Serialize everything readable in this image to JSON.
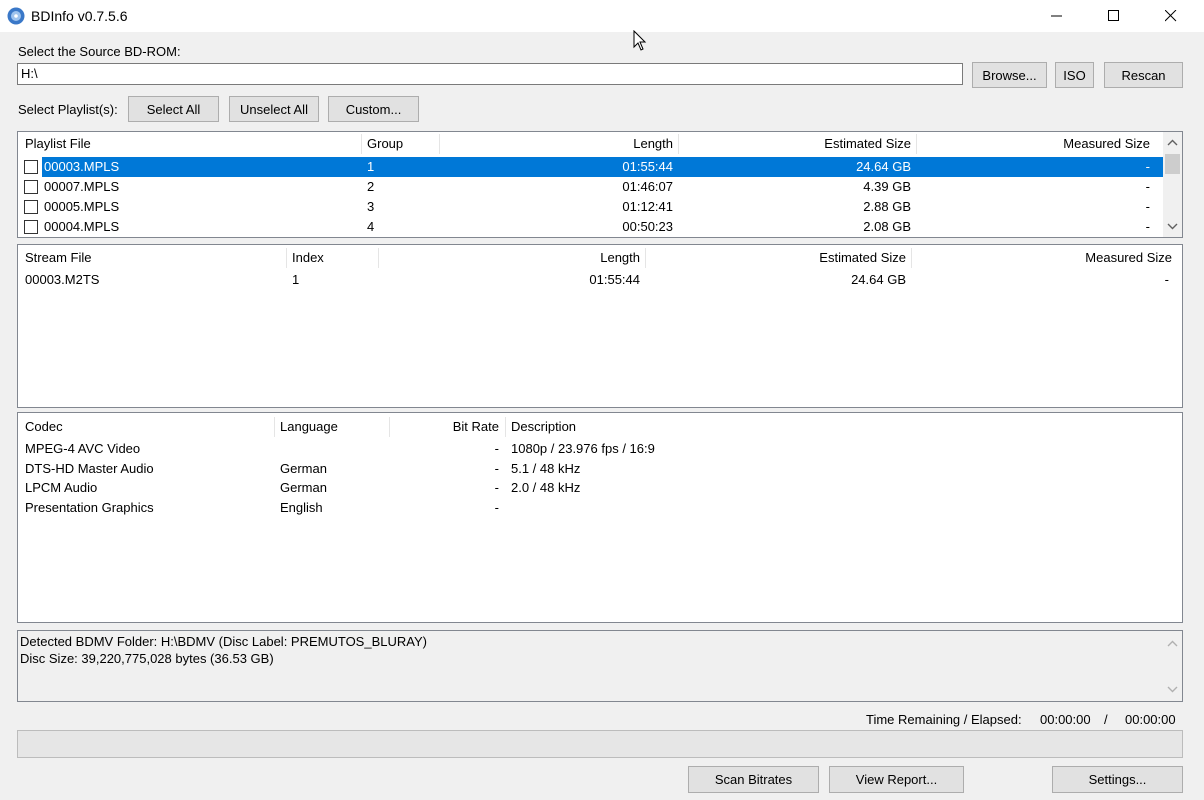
{
  "window": {
    "title": "BDInfo v0.7.5.6"
  },
  "source": {
    "label": "Select the Source BD-ROM:",
    "value": "H:\\",
    "browse_label": "Browse...",
    "iso_label": "ISO",
    "rescan_label": "Rescan"
  },
  "playlist_controls": {
    "label": "Select Playlist(s):",
    "select_all": "Select All",
    "unselect_all": "Unselect All",
    "custom": "Custom..."
  },
  "playlists": {
    "columns": [
      "Playlist File",
      "Group",
      "Length",
      "Estimated Size",
      "Measured Size"
    ],
    "rows": [
      {
        "file": "00003.MPLS",
        "group": "1",
        "length": "01:55:44",
        "estimated": "24.64 GB",
        "measured": "-",
        "selected": true,
        "checked": false
      },
      {
        "file": "00007.MPLS",
        "group": "2",
        "length": "01:46:07",
        "estimated": "4.39 GB",
        "measured": "-",
        "selected": false,
        "checked": false
      },
      {
        "file": "00005.MPLS",
        "group": "3",
        "length": "01:12:41",
        "estimated": "2.88 GB",
        "measured": "-",
        "selected": false,
        "checked": false
      },
      {
        "file": "00004.MPLS",
        "group": "4",
        "length": "00:50:23",
        "estimated": "2.08 GB",
        "measured": "-",
        "selected": false,
        "checked": false
      }
    ]
  },
  "streams": {
    "columns": [
      "Stream File",
      "Index",
      "Length",
      "Estimated Size",
      "Measured Size"
    ],
    "rows": [
      {
        "file": "00003.M2TS",
        "index": "1",
        "length": "01:55:44",
        "estimated": "24.64 GB",
        "measured": "-"
      }
    ]
  },
  "codecs": {
    "columns": [
      "Codec",
      "Language",
      "Bit Rate",
      "Description"
    ],
    "rows": [
      {
        "codec": "MPEG-4 AVC Video",
        "language": "",
        "bitrate": "-",
        "description": "1080p / 23.976 fps / 16:9"
      },
      {
        "codec": "DTS-HD Master Audio",
        "language": "German",
        "bitrate": "-",
        "description": "5.1 / 48 kHz"
      },
      {
        "codec": "LPCM Audio",
        "language": "German",
        "bitrate": "-",
        "description": "2.0 / 48 kHz"
      },
      {
        "codec": "Presentation Graphics",
        "language": "English",
        "bitrate": "-",
        "description": ""
      }
    ]
  },
  "status": {
    "line1": "Detected BDMV Folder: H:\\BDMV (Disc Label: PREMUTOS_BLURAY)",
    "line2": "Disc Size: 39,220,775,028 bytes (36.53 GB)"
  },
  "time": {
    "label": "Time Remaining / Elapsed:",
    "remaining": "00:00:00",
    "separator": "/",
    "elapsed": "00:00:00"
  },
  "progress": {
    "value": 0
  },
  "bottom_buttons": {
    "scan": "Scan Bitrates",
    "report": "View Report...",
    "settings": "Settings..."
  },
  "colors": {
    "selection": "#0078d7",
    "window_bg": "#f0f0f0"
  }
}
